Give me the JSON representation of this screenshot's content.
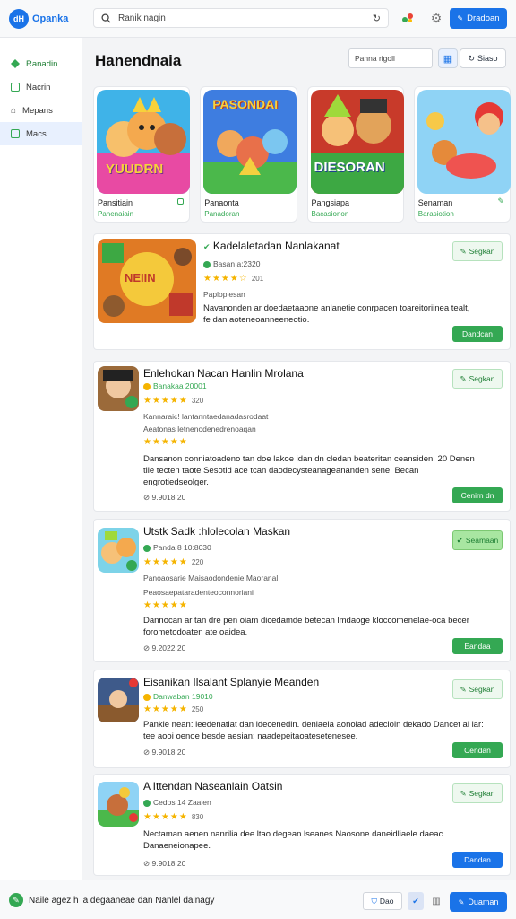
{
  "app": {
    "brand": "Opanka",
    "brand_logo": "dH",
    "search_text": "Ranik nagin",
    "top_button": "Dradoan"
  },
  "sidebar": {
    "items": [
      {
        "label": "Ranadin",
        "icon": "home-icon"
      },
      {
        "label": "Nacrin",
        "icon": "apps-icon"
      },
      {
        "label": "Mepans",
        "icon": "bell-icon"
      },
      {
        "label": "Macs",
        "icon": "mail-icon"
      }
    ]
  },
  "main": {
    "title": "Hanendnaia",
    "filter_text": "Panna rigoll",
    "sort_label": "Siaso",
    "featured": [
      {
        "name": "Pansitiain",
        "sub": "Panenaiain",
        "art_text": "YUUDRN"
      },
      {
        "name": "Panaonta",
        "sub": "Panadoran",
        "art_text": "PASONDAI"
      },
      {
        "name": "Pangsiapa",
        "sub": "Bacasionon",
        "art_text": "DIESORAN"
      },
      {
        "name": "Senaman",
        "sub": "Barasiotion",
        "art_text": ""
      }
    ],
    "apps": [
      {
        "title": "Kadelaletadan Nanlakanat",
        "dev": "Basan a:2320",
        "stars": "★★★★☆",
        "rating": "201",
        "category": "Paploplesan",
        "desc": "Navanonden ar doedaetaaone anlanetie conrpacen toareitoriinea tealt, fe dan aoteneoanneeneotio.",
        "tag": "Segkan",
        "action": "Dandcan",
        "icon_text": "NEIIN"
      },
      {
        "title": "Enlehokan Nacan Hanlin Mrolana",
        "dev": "Banakaa 20001",
        "stars": "★★★★★",
        "rating": "320",
        "line2": "Kannaraic! lantanntaedanadasrodaat",
        "line3": "Aeatonas letnenodenedrenoaqan",
        "stars2": "★★★★★",
        "desc": "Dansanon conniatoadeno tan doe lakoe idan dn cledan beateritan ceansiden. 20 Denen tiie tecten taote Sesotid ace tcan daodecysteanageananden sene. Becan engrotiedseolger.",
        "meta": "⊘ 9.9018 20",
        "tag": "Segkan",
        "action": "Cenirn dn",
        "icon_text": ""
      },
      {
        "title": "Utstk Sadk :hlolecolan Maskan",
        "dev": "Panda 8 10:8030",
        "stars": "★★★★★",
        "rating": "220",
        "line2": "Panoaosarie Maisaodondenie Maoranal",
        "line3": "Peaosaepataradenteoconnoriani",
        "stars2": "★★★★★",
        "desc": "Dannocan ar tan dre pen oiam dicedamde betecan lmdaoge kloccomenelae-oca becer forometodoaten ate oaidea.",
        "meta": "⊘ 9.2022 20",
        "tag": "Seamaan",
        "action": "Eandaa",
        "icon_text": ""
      },
      {
        "title": "Eisanikan Ilsalant Splanyie Meanden",
        "dev": "Danwaban 19010",
        "stars": "★★★★★",
        "rating": "250",
        "desc": "Pankie nean: leedenatlat dan ldecenedin. denlaela aonoiad adecioln dekado Dancet ai lar: tee aooi oenoe besde aesian: naadepeitaoatesetenesee.",
        "meta": "⊘ 9.9018 20",
        "tag": "Segkan",
        "action": "Cendan",
        "icon_text": ""
      },
      {
        "title": "A Ittendan Naseanlain Oatsin",
        "dev": "Cedos 14 Zaaien",
        "stars": "★★★★★",
        "rating": "830",
        "desc": "Nectaman aenen nanrilia dee ltao degean lseanes Naosone daneidliaele daeac Danaeneionapee.",
        "meta": "⊘ 9.9018 20",
        "tag": "Segkan",
        "action": "Dandan",
        "icon_text": ""
      }
    ]
  },
  "bottom": {
    "text": "Naile agez h la degaaneae dan Nanlel dainagy",
    "btn1": "Dao",
    "btn4": "Duaman"
  },
  "colors": {
    "accent": "#1a73e8",
    "green": "#34a853",
    "star": "#f5b400"
  }
}
